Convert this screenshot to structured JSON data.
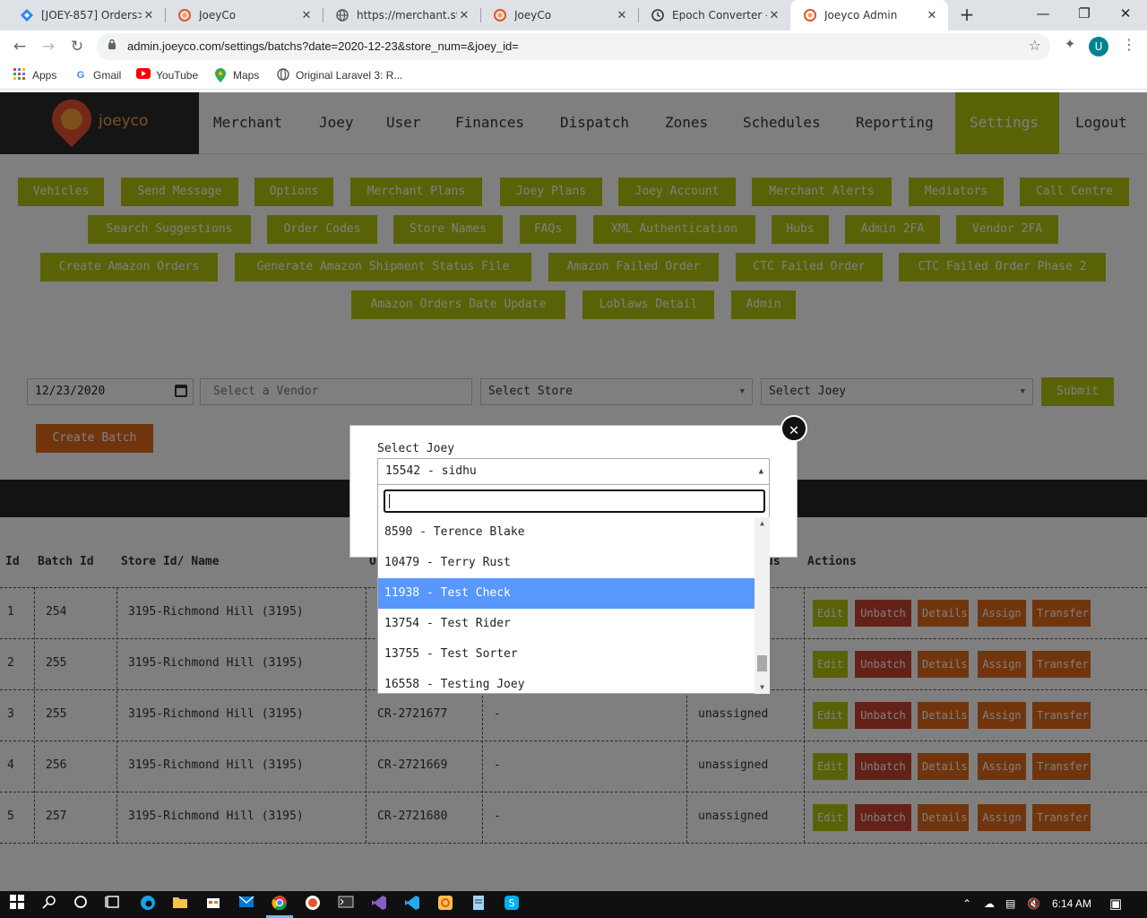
{
  "browser": {
    "tabs": [
      {
        "title": "[JOEY-857] Orders>c",
        "icon": "jira-diamond-icon"
      },
      {
        "title": "JoeyCo",
        "icon": "joeyco-favicon-icon"
      },
      {
        "title": "https://merchant.sta",
        "icon": "globe-icon"
      },
      {
        "title": "JoeyCo",
        "icon": "joeyco-favicon-icon"
      },
      {
        "title": "Epoch Converter - U",
        "icon": "clock-icon"
      },
      {
        "title": "Joeyco Admin",
        "icon": "joeyco-favicon-icon"
      }
    ],
    "close_glyph": "✕",
    "url": "admin.joeyco.com/settings/batchs?date=2020-12-23&store_num=&joey_id=",
    "profile_initial": "U",
    "bookmarks": [
      {
        "label": "Apps",
        "icon": "apps-grid-icon"
      },
      {
        "label": "Gmail",
        "icon": "google-icon"
      },
      {
        "label": "YouTube",
        "icon": "youtube-icon"
      },
      {
        "label": "Maps",
        "icon": "maps-pin-icon"
      },
      {
        "label": "Original Laravel 3: R...",
        "icon": "globe-icon"
      }
    ]
  },
  "site": {
    "logo_text": "joeyco",
    "nav": [
      "Merchant",
      "Joey",
      "User",
      "Finances",
      "Dispatch",
      "Zones",
      "Schedules",
      "Reporting",
      "Settings",
      "Logout"
    ],
    "active_nav": "Settings",
    "settings_buttons": [
      "Vehicles",
      "Send Message",
      "Options",
      "Merchant Plans",
      "Joey Plans",
      "Joey Account",
      "Merchant Alerts",
      "Mediators",
      "Call Centre",
      "Search Suggestions",
      "Order Codes",
      "Store Names",
      "FAQs",
      "XML Authentication",
      "Hubs",
      "Admin 2FA",
      "Vendor 2FA",
      "Create Amazon Orders",
      "Generate Amazon Shipment Status File",
      "Amazon Failed Order",
      "CTC Failed Order",
      "CTC Failed Order Phase 2",
      "Amazon Orders Date Update",
      "Loblaws Detail",
      "Admin"
    ],
    "filters": {
      "date": "12/23/2020",
      "vendor_placeholder": "Select a Vendor",
      "store": "Select Store",
      "joey": "Select Joey",
      "submit": "Submit"
    },
    "create_batch": "Create Batch",
    "table": {
      "headers": [
        "Id",
        "Batch Id",
        "Store Id/ Name",
        "O",
        "us",
        "Actions"
      ],
      "rows": [
        {
          "id": "1",
          "batch": "254",
          "store": "3195-Richmond Hill (3195)",
          "order": "",
          "joey": "",
          "status": "d"
        },
        {
          "id": "2",
          "batch": "255",
          "store": "3195-Richmond Hill (3195)",
          "order": "",
          "joey": "",
          "status": "d"
        },
        {
          "id": "3",
          "batch": "255",
          "store": "3195-Richmond Hill (3195)",
          "order": "CR-2721677",
          "joey": "-",
          "status": "unassigned"
        },
        {
          "id": "4",
          "batch": "256",
          "store": "3195-Richmond Hill (3195)",
          "order": "CR-2721669",
          "joey": "-",
          "status": "unassigned"
        },
        {
          "id": "5",
          "batch": "257",
          "store": "3195-Richmond Hill (3195)",
          "order": "CR-2721680",
          "joey": "-",
          "status": "unassigned"
        }
      ],
      "actions": [
        "Edit",
        "Unbatch",
        "Details",
        "Assign",
        "Transfer"
      ]
    }
  },
  "modal": {
    "label": "Select Joey",
    "selected": "15542 - sidhu",
    "search_value": "",
    "options": [
      "8590 - Terence Blake",
      "10479 - Terry Rust",
      "11938 - Test Check",
      "13754 - Test Rider",
      "13755 - Test Sorter",
      "16558 - Testing Joey"
    ],
    "highlighted": "11938 - Test Check",
    "close_glyph": "✕"
  },
  "taskbar": {
    "time": "6:14 AM",
    "apps": [
      "start-icon",
      "search-icon",
      "cortana-icon",
      "task-view-icon",
      "edge-icon",
      "file-explorer-icon",
      "store-icon",
      "mail-icon",
      "chrome-icon",
      "app-icon",
      "terminal-icon",
      "visual-studio-icon",
      "vscode-icon",
      "joeyco-app-icon",
      "notepad-icon",
      "skype-icon"
    ]
  },
  "colors": {
    "accent_green": "#b5c40e",
    "orange": "#e36b1c",
    "red": "#c9432e",
    "highlight_blue": "#5897fb"
  }
}
